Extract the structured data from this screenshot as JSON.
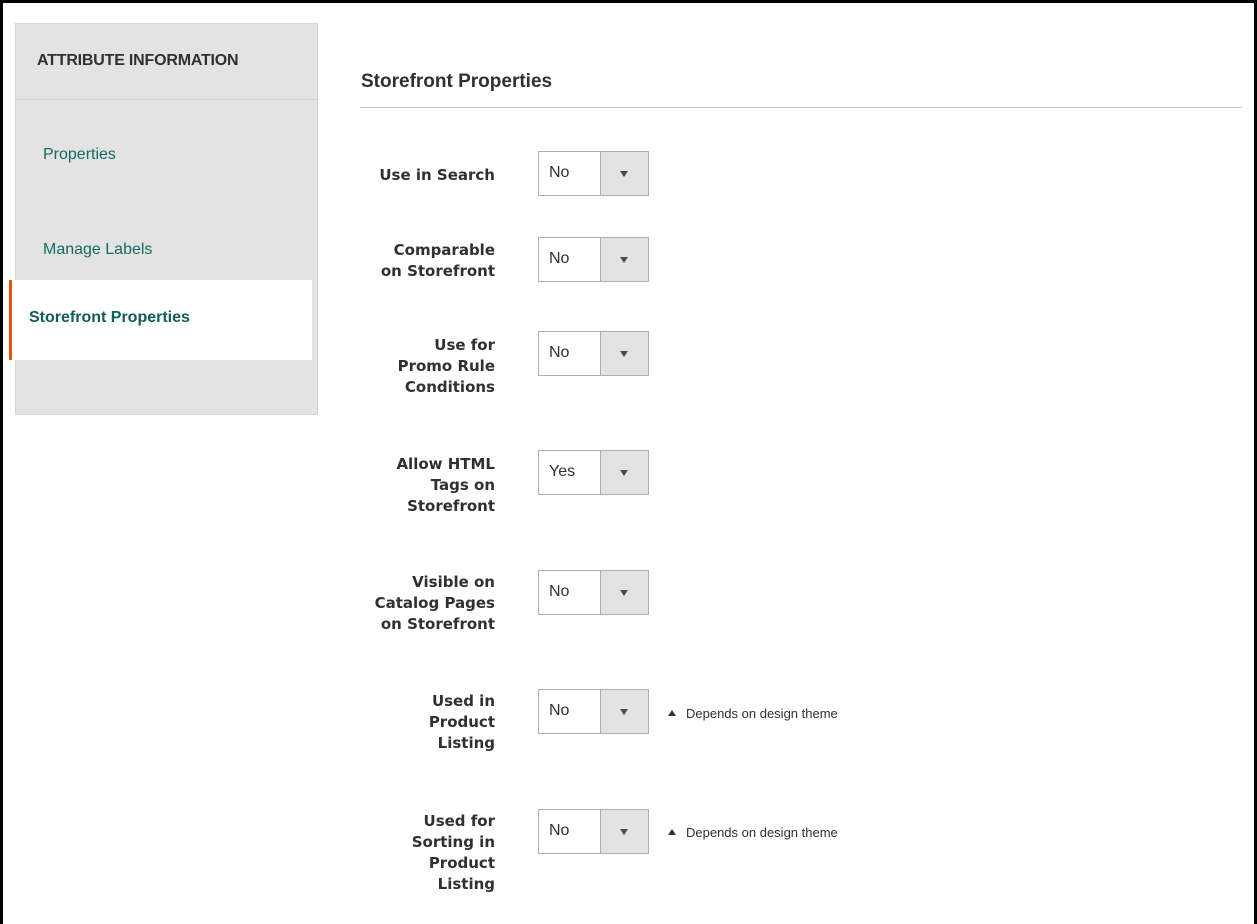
{
  "sidebar": {
    "header": "ATTRIBUTE INFORMATION",
    "items": [
      {
        "label": "Properties"
      },
      {
        "label": "Manage Labels"
      },
      {
        "label": "Storefront Properties"
      }
    ]
  },
  "section": {
    "title": "Storefront Properties"
  },
  "fields": [
    {
      "label_lines": [
        "Use in Search"
      ],
      "value": "No"
    },
    {
      "label_lines": [
        "Comparable",
        "on Storefront"
      ],
      "value": "No"
    },
    {
      "label_lines": [
        "Use for",
        "Promo Rule",
        "Conditions"
      ],
      "value": "No"
    },
    {
      "label_lines": [
        "Allow HTML",
        "Tags on",
        "Storefront"
      ],
      "value": "Yes"
    },
    {
      "label_lines": [
        "Visible on",
        "Catalog Pages",
        "on Storefront"
      ],
      "value": "No"
    },
    {
      "label_lines": [
        "Used in",
        "Product",
        "Listing"
      ],
      "value": "No",
      "note": "Depends on design theme"
    },
    {
      "label_lines": [
        "Used for",
        "Sorting in",
        "Product",
        "Listing"
      ],
      "value": "No",
      "note": "Depends on design theme"
    }
  ],
  "colors": {
    "accent": "#eb5202",
    "link": "#166a5e"
  }
}
